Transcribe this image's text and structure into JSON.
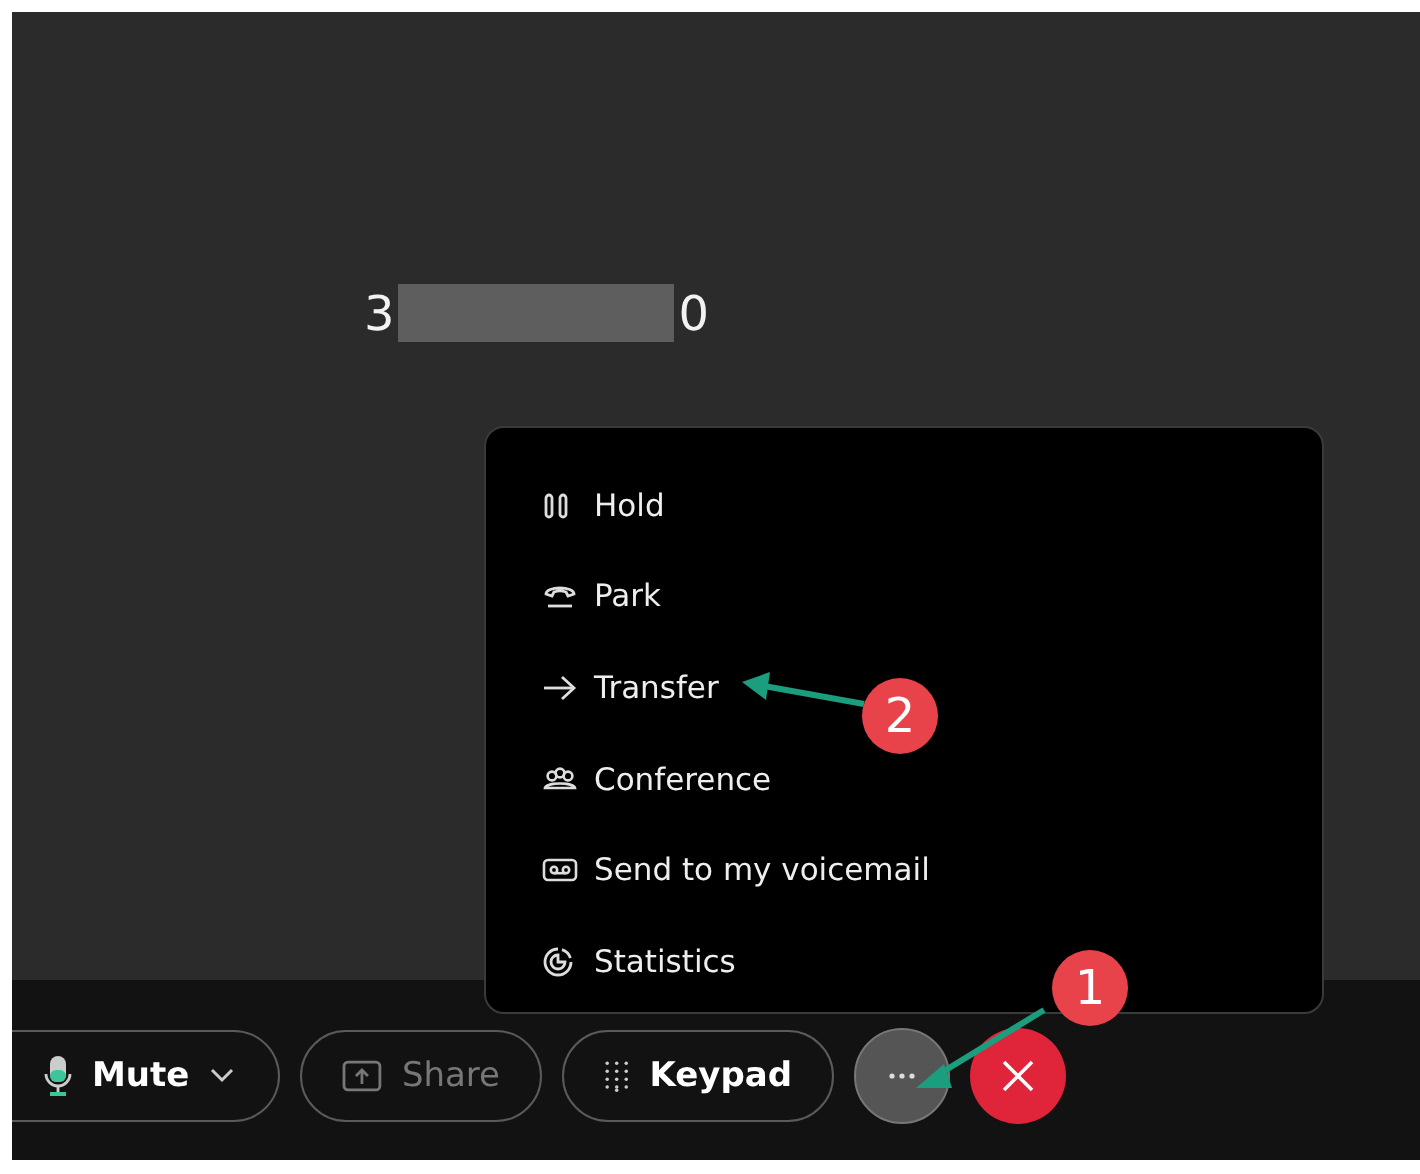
{
  "call": {
    "number_start": "3",
    "number_end": "0"
  },
  "menu": {
    "items": [
      {
        "label": "Hold"
      },
      {
        "label": "Park"
      },
      {
        "label": "Transfer"
      },
      {
        "label": "Conference"
      },
      {
        "label": "Send to my voicemail"
      },
      {
        "label": "Statistics"
      }
    ]
  },
  "controls": [
    {
      "kind": "mute",
      "label": "Mute",
      "disabled": false
    },
    {
      "kind": "share",
      "label": "Share",
      "disabled": true
    },
    {
      "kind": "keypad",
      "label": "Keypad",
      "disabled": false
    },
    {
      "kind": "more",
      "expanded": true
    },
    {
      "kind": "end"
    }
  ],
  "callouts": [
    {
      "label": "1"
    },
    {
      "label": "2"
    }
  ]
}
